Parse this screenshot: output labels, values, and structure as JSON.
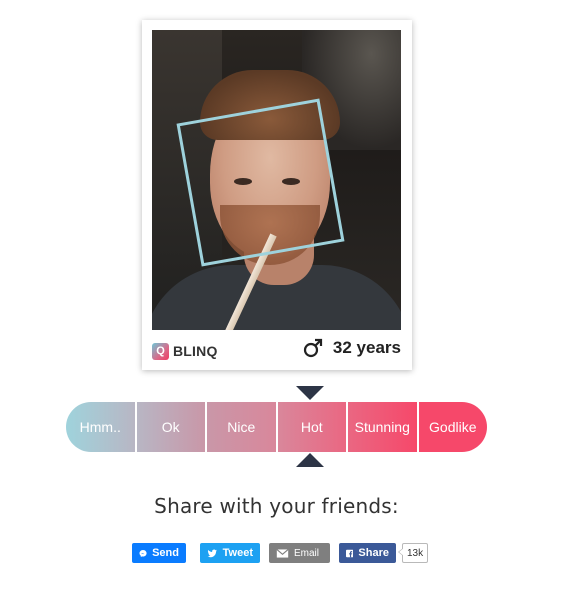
{
  "card": {
    "brand_name": "BLINQ",
    "brand_icon": "blinq-logo",
    "gender_icon": "male-symbol-icon",
    "age_label": "32 years"
  },
  "rating": {
    "options": [
      "Hmm..",
      "Ok",
      "Nice",
      "Hot",
      "Stunning",
      "Godlike"
    ],
    "selected": "Hot",
    "colors": [
      "#9fd3dc",
      "#b8b6c4",
      "#c997a8",
      "#d9879b",
      "#ea6782",
      "#f6486a"
    ],
    "marker_color": "#2d3546"
  },
  "share": {
    "title": "Share with your friends:",
    "send_label": "Send",
    "tweet_label": "Tweet",
    "email_label": "Email",
    "fb_share_label": "Share",
    "fb_count": "13k"
  },
  "colors": {
    "face_box": "#9ed2dc",
    "messenger": "#0a7cff",
    "twitter": "#1da1f2",
    "email": "#7f7f7f",
    "facebook": "#3b5998"
  }
}
